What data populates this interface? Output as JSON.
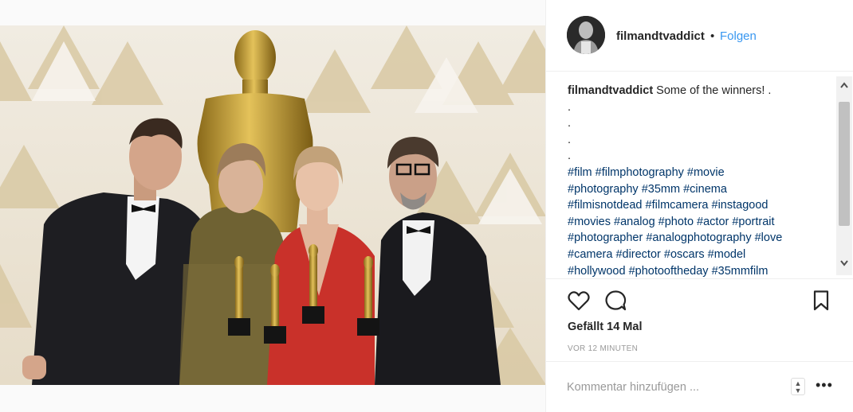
{
  "post": {
    "username": "filmandtvaddict",
    "separator": "•",
    "follow_label": "Folgen",
    "caption_text": " Some of the winners! .",
    "caption_dots": [
      ".",
      ".",
      ".",
      "."
    ],
    "hashtag_lines": [
      "#film #filmphotography #movie",
      "#photography #35mm #cinema",
      "#filmisnotdead #filmcamera #instagood",
      "#movies #analog #photo #actor #portrait",
      "#photographer #analogphotography #love",
      "#camera #director #oscars #model",
      "#hollywood #photooftheday #35mmfilm"
    ],
    "likes": "Gefällt 14 Mal",
    "timestamp": "VOR 12 MINUTEN",
    "comment_placeholder": "Kommentar hinzufügen ...",
    "more_label": "•••"
  },
  "icons": {
    "like": "heart-icon",
    "comment": "comment-icon",
    "save": "bookmark-icon",
    "scroll_up": "chevron-up-icon",
    "scroll_down": "chevron-down-icon"
  },
  "colors": {
    "link_blue": "#3897f0",
    "hashtag": "#003569",
    "muted": "#999999",
    "border": "#efefef"
  }
}
